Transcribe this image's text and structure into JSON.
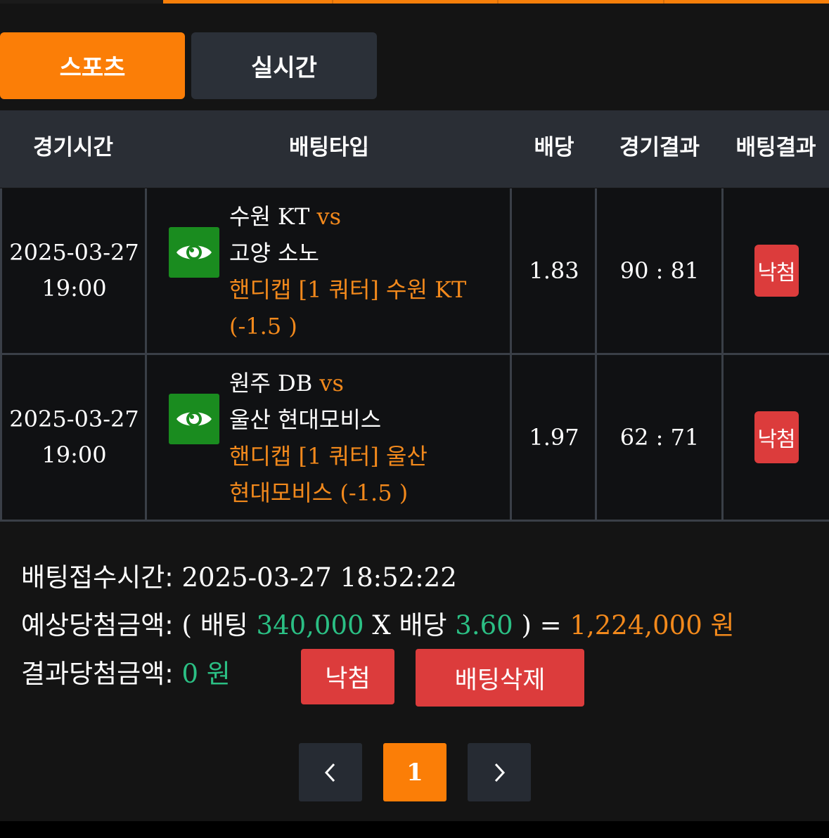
{
  "tabs": {
    "sports": "스포츠",
    "live": "실시간"
  },
  "table": {
    "headers": [
      "경기시간",
      "배팅타입",
      "배당",
      "경기결과",
      "배팅결과"
    ],
    "rows": [
      {
        "date": "2025-03-27",
        "time": "19:00",
        "home": "수원 KT",
        "vs": "vs",
        "away": "고양 소노",
        "handicap_line1": "핸디캡 [1 쿼터] 수원 KT",
        "handicap_line2": "(-1.5 )",
        "odds": "1.83",
        "score": "90 : 81",
        "result": "낙첨"
      },
      {
        "date": "2025-03-27",
        "time": "19:00",
        "home": "원주 DB",
        "vs": "vs",
        "away": "울산 현대모비스",
        "handicap_line1": "핸디캡 [1 쿼터] 울산",
        "handicap_line2": "현대모비스 (-1.5 )",
        "odds": "1.97",
        "score": "62 : 71",
        "result": "낙첨"
      }
    ]
  },
  "summary": {
    "bet_time_label": "배팅접수시간:",
    "bet_time_value": "2025-03-27 18:52:22",
    "expected_label": "예상당첨금액:",
    "open_paren": "(",
    "bet_word": "배팅",
    "bet_amount": "340,000",
    "x": "X",
    "odds_word": "배당",
    "total_odds": "3.60",
    "close_eq": ") =",
    "expected_amount": "1,224,000 원",
    "result_label": "결과당첨금액:",
    "result_amount": "0 원",
    "status_button": "낙첨",
    "delete_button": "배팅삭제"
  },
  "pagination": {
    "current": "1"
  },
  "icons": {
    "prev": "chevron-left-icon",
    "next": "chevron-right-icon",
    "view": "eye-icon"
  },
  "colors": {
    "accent": "#fb7e07",
    "lose": "#dc3c3c",
    "green": "#2bbf84",
    "highlight": "#f2891c"
  }
}
